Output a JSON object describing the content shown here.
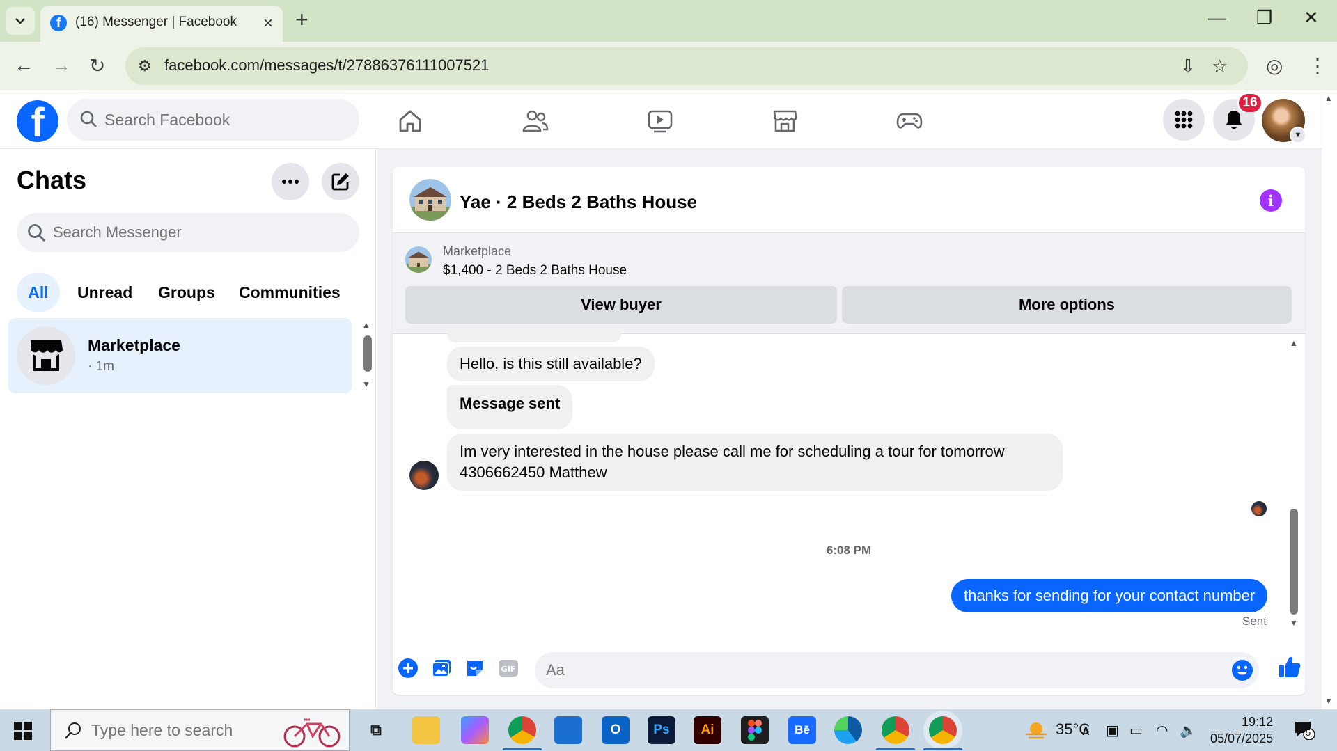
{
  "browser": {
    "tab_title": "(16) Messenger | Facebook",
    "new_tab": "+",
    "url": "facebook.com/messages/t/27886376111007521",
    "controls": {
      "minimize": "—",
      "restore": "❐",
      "close": "✕"
    }
  },
  "facebook": {
    "logo_letter": "f",
    "search_placeholder": "Search Facebook",
    "nav": [
      "home-icon",
      "friends-icon",
      "watch-icon",
      "marketplace-icon",
      "gaming-icon"
    ],
    "notification_count": "16"
  },
  "sidebar": {
    "title": "Chats",
    "search_placeholder": "Search Messenger",
    "filters": [
      "All",
      "Unread",
      "Groups",
      "Communities"
    ],
    "active_filter": "All",
    "chats": [
      {
        "name": "Marketplace",
        "time": "· 1m"
      }
    ]
  },
  "conversation": {
    "title": "Yae · 2 Beds 2 Baths House",
    "listing": {
      "label": "Marketplace",
      "price_title": "$1,400 - 2 Beds 2 Baths House",
      "view_buyer": "View buyer",
      "more_options": "More options"
    },
    "messages": [
      {
        "from": "peer",
        "text": "Hello, is this still available?"
      },
      {
        "from": "peer",
        "text": "Message sent",
        "bold": true
      },
      {
        "from": "peer",
        "text": "Im very interested in the house please call me for scheduling a tour for tomorrow 4306662450 Matthew"
      }
    ],
    "timestamp": "6:08 PM",
    "outgoing": {
      "text": "thanks for sending for your contact number",
      "status": "Sent"
    },
    "composer_placeholder": "Aa"
  },
  "taskbar": {
    "search_placeholder": "Type here to search",
    "weather": "35°C",
    "time": "19:12",
    "date": "05/07/2025",
    "notification_count": "5"
  },
  "colors": {
    "fb_blue": "#0866ff",
    "badge_red": "#e41e3f",
    "info_purple": "#a033ff",
    "chrome_green": "#d3e3c6"
  }
}
